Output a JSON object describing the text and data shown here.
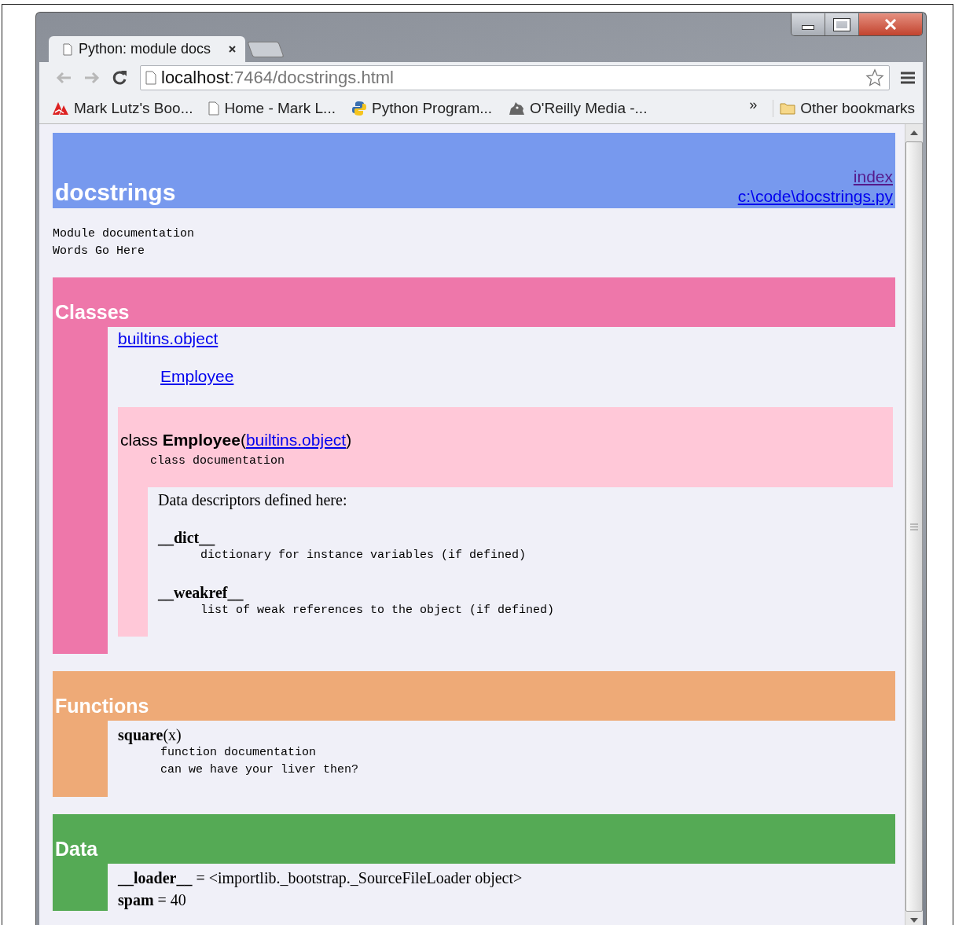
{
  "tabs": [
    {
      "title": "Python: module docs",
      "selected": true
    }
  ],
  "address": {
    "host": "localhost",
    "path": ":7464/docstrings.html"
  },
  "bookmarks": [
    {
      "kind": "logo",
      "label": "Mark Lutz's Boo..."
    },
    {
      "kind": "page",
      "label": "Home - Mark L..."
    },
    {
      "kind": "python",
      "label": "Python Program..."
    },
    {
      "kind": "creature",
      "label": "O'Reilly Media -..."
    }
  ],
  "bookmarks_overflow": "»",
  "other_bookmarks": "Other bookmarks",
  "page": {
    "title": "docstrings",
    "links": [
      {
        "text": "index",
        "visited": true
      },
      {
        "text": "c:\\code\\docstrings.py",
        "visited": false
      }
    ],
    "doc": [
      "Module documentation",
      "Words Go Here"
    ],
    "sections": [
      {
        "kind": "classes",
        "title": "Classes",
        "color": "#ee77aa",
        "tree": [
          {
            "text": "builtins.object",
            "children": [
              {
                "text": "Employee"
              }
            ]
          }
        ],
        "class": {
          "prefix": "class **Employee**(",
          "base": "builtins.object",
          "suffix": ")",
          "doc": "class documentation",
          "heading": "Data descriptors defined here:",
          "descriptors": [
            {
              "name": "__dict__",
              "doc": "dictionary for instance variables (if defined)"
            },
            {
              "name": "__weakref__",
              "doc": "list of weak references to the object (if defined)"
            }
          ]
        }
      },
      {
        "kind": "functions",
        "title": "Functions",
        "color": "#eeaa77",
        "functions": [
          {
            "signature": "**square**(x)",
            "doc": [
              "function documentation",
              "can we have your liver then?"
            ]
          }
        ]
      },
      {
        "kind": "data",
        "title": "Data",
        "color": "#55aa55",
        "items": [
          "**__loader__** = <importlib._bootstrap._SourceFileLoader object>",
          "**spam** = 40"
        ]
      }
    ]
  }
}
